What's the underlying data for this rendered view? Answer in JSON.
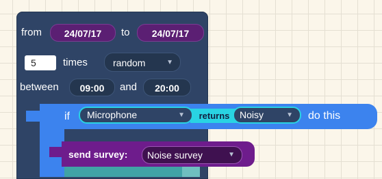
{
  "schedule": {
    "from_label": "from",
    "from_date": "24/07/17",
    "to_label": "to",
    "to_date": "24/07/17",
    "times_value": "5",
    "times_label": "times",
    "mode_value": "random",
    "between_label": "between",
    "start_time": "09:00",
    "and_label": "and",
    "end_time": "20:00"
  },
  "condition": {
    "if_label": "if",
    "sensor_value": "Microphone",
    "returns_label": "returns",
    "state_value": "Noisy",
    "do_label": "do this"
  },
  "action": {
    "send_label": "send survey:",
    "survey_value": "Noise survey"
  },
  "colors": {
    "canvas": "#fbf6ea",
    "schedule_block": "#2f4466",
    "date_pill": "#5b1f73",
    "if_block": "#3c83ee",
    "returns_block": "#29d3e3",
    "send_block": "#6e1c8c"
  },
  "icons": {
    "dropdown": "chevron-down-icon"
  }
}
